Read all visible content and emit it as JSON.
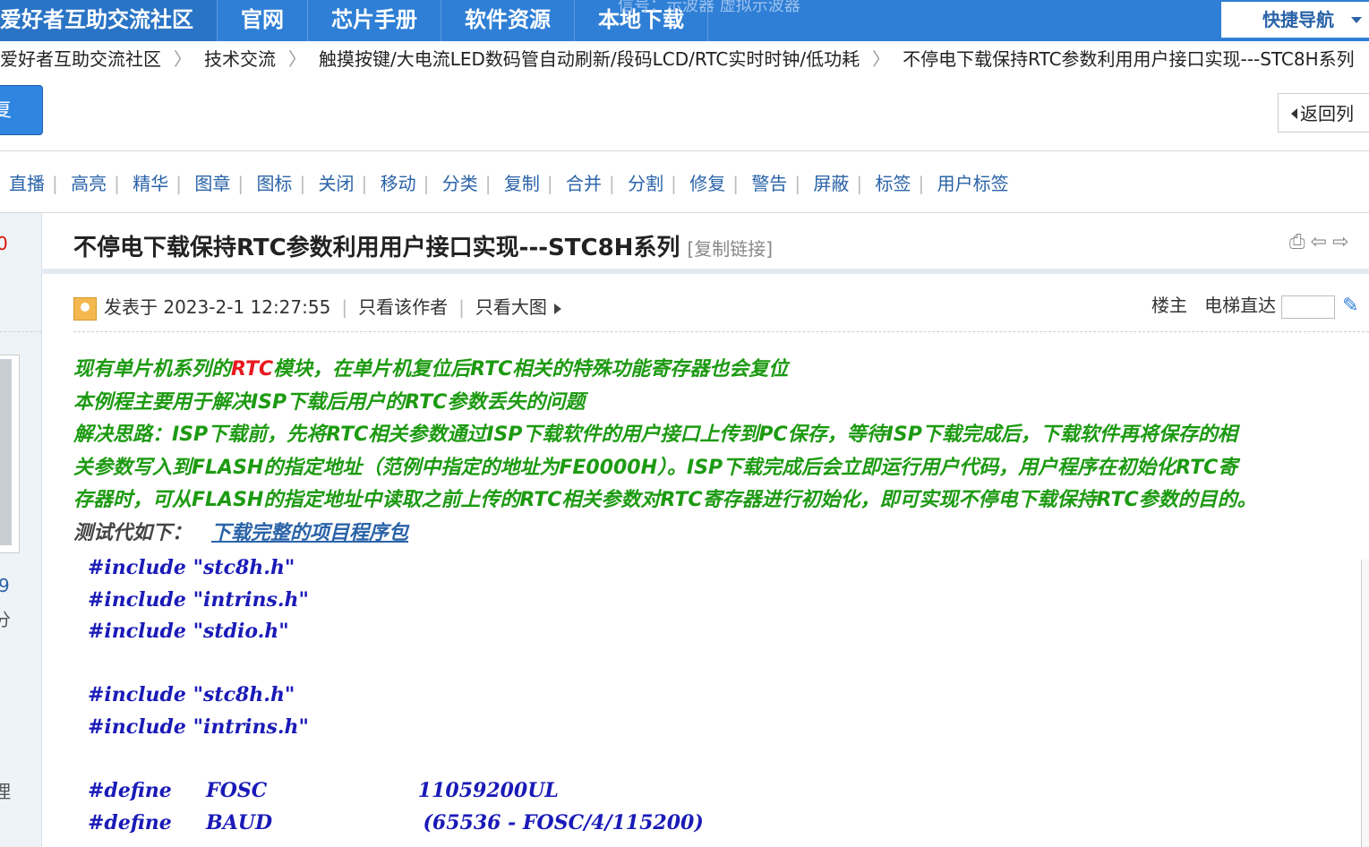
{
  "topnav": {
    "tabs": [
      "爱好者互助交流社区",
      "官网",
      "芯片手册",
      "软件资源",
      "本地下载"
    ],
    "faint_text": "信号：示波器  虚拟示波器",
    "quick_nav": "快捷导航"
  },
  "breadcrumbs": [
    "爱好者互助交流社区",
    "技术交流",
    "触摸按键/大电流LED数码管自动刷新/段码LCD/RTC实时时钟/低功耗",
    "不停电下载保持RTC参数利用用户接口实现---STC8H系列"
  ],
  "left_button": "复",
  "back_button": "返回列",
  "mod_actions": [
    "直播",
    "高亮",
    "精华",
    "图章",
    "图标",
    "关闭",
    "移动",
    "分类",
    "复制",
    "合并",
    "分割",
    "修复",
    "警告",
    "屏蔽",
    "标签",
    "用户标签"
  ],
  "left_column": {
    "red_num": "0",
    "num": "9",
    "fen": "分",
    "li": "理"
  },
  "post": {
    "title": "不停电下载保持RTC参数利用用户接口实现---STC8H系列",
    "copy_link": "[复制链接]",
    "posted_at": "发表于 2023-2-1 12:27:55",
    "only_author": "只看该作者",
    "only_big_image": "只看大图",
    "floor": "楼主",
    "elevator": "电梯直达",
    "body": {
      "l1_pre": "现有单片机系列的",
      "l1_red": "RTC",
      "l1_post": "模块，在单片机复位后RTC相关的特殊功能寄存器也会复位",
      "l2": "本例程主要用于解决ISP下载后用户的RTC参数丢失的问题",
      "l3": "解决思路：ISP下载前，先将RTC相关参数通过ISP下载软件的用户接口上传到PC保存，等待ISP下载完成后，下载软件再将保存的相",
      "l4": "关参数写入到FLASH的指定地址（范例中指定的地址为FE0000H）。ISP下载完成后会立即运行用户代码，用户程序在初始化RTC寄",
      "l5": "存器时，可从FLASH的指定地址中读取之前上传的RTC相关参数对RTC寄存器进行初始化，即可实现不停电下载保持RTC参数的目的。",
      "l6": "测试代如下：",
      "download_link": "下载完整的项目程序包"
    },
    "code_lines": [
      "#include \"stc8h.h\"",
      "#include \"intrins.h\"",
      "#include \"stdio.h\"",
      "",
      "#include \"stc8h.h\"",
      "#include \"intrins.h\"",
      "",
      "#define     FOSC                      11059200UL",
      "#define     BAUD                      (65536 - FOSC/4/115200)"
    ]
  }
}
